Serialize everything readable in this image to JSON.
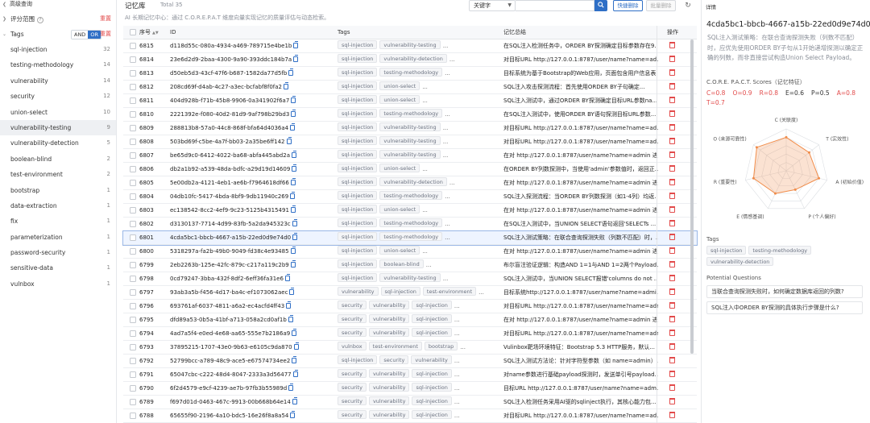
{
  "sidebar": {
    "advanced_search": "高级查询",
    "score_range": "评分范围",
    "score_reset": "重置",
    "tags_title": "Tags",
    "and_label": "AND",
    "or_label": "OR",
    "tags_reset": "重置",
    "tags": [
      {
        "name": "sql-injection",
        "count": "32"
      },
      {
        "name": "testing-methodology",
        "count": "14"
      },
      {
        "name": "vulnerability",
        "count": "14"
      },
      {
        "name": "security",
        "count": "12"
      },
      {
        "name": "union-select",
        "count": "10"
      },
      {
        "name": "vulnerability-testing",
        "count": "9"
      },
      {
        "name": "vulnerability-detection",
        "count": "5"
      },
      {
        "name": "boolean-blind",
        "count": "2"
      },
      {
        "name": "test-environment",
        "count": "2"
      },
      {
        "name": "bootstrap",
        "count": "1"
      },
      {
        "name": "data-extraction",
        "count": "1"
      },
      {
        "name": "fix",
        "count": "1"
      },
      {
        "name": "parameterization",
        "count": "1"
      },
      {
        "name": "password-security",
        "count": "1"
      },
      {
        "name": "sensitive-data",
        "count": "1"
      },
      {
        "name": "vulnbox",
        "count": "1"
      }
    ]
  },
  "main": {
    "title": "记忆库",
    "total": "Total 35",
    "subtitle": "AI 长期记忆中心：通过 C.O.R.E.P.A.T 维度向量实现记忆的质量评估与动态检索。",
    "search_field": "关键字",
    "search_placeholder": "",
    "quick_delete": "快捷删除",
    "batch_delete": "批量删除",
    "columns": {
      "seq": "序号",
      "id": "ID",
      "tags": "Tags",
      "summary": "记忆总结",
      "ops": "操作"
    },
    "rows": [
      {
        "seq": "6815",
        "id": "d118d55c-080a-4934-a469-789715e4be1b",
        "tags": [
          "sql-injection",
          "vulnerability-testing"
        ],
        "summary": "在SQL注入检测任务中，ORDER BY探测确定目标参数存在9..."
      },
      {
        "seq": "6814",
        "id": "23e6d2d9-2baa-4300-9a90-393ddc184b7a",
        "tags": [
          "sql-injection",
          "vulnerability-detection"
        ],
        "summary": "对目标URL http://127.0.0.1:8787/user/name?name=ad..."
      },
      {
        "seq": "6813",
        "id": "d50eb5d3-43cf-47f6-b687-1582da77d5fb",
        "tags": [
          "sql-injection",
          "testing-methodology"
        ],
        "summary": "目标系统为基于Bootstrap的Web应用，页面包含用户信息表..."
      },
      {
        "seq": "6812",
        "id": "208cd69f-d4ab-4c27-a3ec-bcfabf8f0fa2",
        "tags": [
          "sql-injection",
          "union-select"
        ],
        "summary": "SQL注入攻击探测流程：首先使用ORDER BY子句确定..."
      },
      {
        "seq": "6811",
        "id": "404d928b-f71b-45b8-9906-0a341902f6a7",
        "tags": [
          "sql-injection",
          "union-select"
        ],
        "summary": "SQL注入测试中，通过ORDER BY探测确定目标URL参数na..."
      },
      {
        "seq": "6810",
        "id": "2221392e-f080-40d2-81d9-9af798b29bd3",
        "tags": [
          "sql-injection",
          "testing-methodology"
        ],
        "summary": "在SQL注入测试中，使用ORDER BY语句探测目标URL参数..."
      },
      {
        "seq": "6809",
        "id": "288813b8-57a0-44c8-868f-bfa64d4036a4",
        "tags": [
          "sql-injection",
          "vulnerability-testing"
        ],
        "summary": "对目标URL http://127.0.0.1:8787/user/name?name=ad..."
      },
      {
        "seq": "6808",
        "id": "503bd69f-c5be-4a7f-bb03-2a35be6ff142",
        "tags": [
          "sql-injection",
          "vulnerability-testing"
        ],
        "summary": "对目标URL http://127.0.0.1:8787/user/name?name=ad..."
      },
      {
        "seq": "6807",
        "id": "be65d9c0-6412-4022-ba68-abfa445abd2a",
        "tags": [
          "sql-injection",
          "vulnerability-testing"
        ],
        "summary": "在对 http://127.0.0.1:8787/user/name?name=admin 进..."
      },
      {
        "seq": "6806",
        "id": "db2a1b92-a539-48da-bdfc-a29d19d14609",
        "tags": [
          "sql-injection",
          "union-select"
        ],
        "summary": "在ORDER BY列数探测中，当使用'admin'参数值时，返回正..."
      },
      {
        "seq": "6805",
        "id": "5e00db2a-4121-4eb1-ae6b-f7964618df66",
        "tags": [
          "sql-injection",
          "vulnerability-detection"
        ],
        "summary": "在对 http://127.0.0.1:8787/user/name?name=admin 进..."
      },
      {
        "seq": "6804",
        "id": "04db10fc-5417-4bda-8bf9-9db11940c269",
        "tags": [
          "sql-injection",
          "testing-methodology"
        ],
        "summary": "SQL注入探测流程：当ORDER BY列数探测（如1-4列）均返..."
      },
      {
        "seq": "6803",
        "id": "ec138542-8cc2-4ef9-9c23-5125b4315491",
        "tags": [
          "sql-injection",
          "union-select"
        ],
        "summary": "在对 http://127.0.0.1:8787/user/name?name=admin 进..."
      },
      {
        "seq": "6802",
        "id": "d3130137-7714-4d99-83fb-5a2da945323c",
        "tags": [
          "sql-injection",
          "testing-methodology"
        ],
        "summary": "在SQL注入测试中，当UNION SELECT语句返回'SELECTs ..."
      },
      {
        "seq": "6801",
        "id": "4cda5bc1-bbcb-4667-a15b-22ed0d9e74d0",
        "tags": [
          "sql-injection",
          "testing-methodology"
        ],
        "summary": "SQL注入测试策略：在联合查询探测失败（列数不匹配）时，..."
      },
      {
        "seq": "6800",
        "id": "5318297a-fa2b-49b0-9049-fd38c4e93485",
        "tags": [
          "sql-injection",
          "union-select"
        ],
        "summary": "在对 http://127.0.0.1:8787/user/name?name=admin 进..."
      },
      {
        "seq": "6799",
        "id": "2eb2263b-125e-42fc-879c-c217a119c2b9",
        "tags": [
          "sql-injection",
          "boolean-blind"
        ],
        "summary": "布尔盲注验证逻辑：构造AND 1=1与AND 1=2两个Payload..."
      },
      {
        "seq": "6798",
        "id": "0cd79247-3bba-432f-8df2-6eff36fa31e6",
        "tags": [
          "sql-injection",
          "vulnerability-testing"
        ],
        "summary": "SQL注入测试中，当UNION SELECT报错'columns do not ..."
      },
      {
        "seq": "6797",
        "id": "93ab3a5b-f456-4d17-ba4c-ef1073062aec",
        "tags": [
          "vulnerability",
          "sql-injection",
          "test-environment"
        ],
        "summary": "目标系统http://127.0.0.1:8787/user/name?name=admi..."
      },
      {
        "seq": "6796",
        "id": "693761af-6037-4811-a6a2-ec4acfd4ff43",
        "tags": [
          "security",
          "vulnerability",
          "sql-injection"
        ],
        "summary": "对目标URL http://127.0.0.1:8787/user/name?name=adm..."
      },
      {
        "seq": "6795",
        "id": "dfd89a53-0b5a-41bf-a713-058a2cd0af1b",
        "tags": [
          "security",
          "vulnerability",
          "sql-injection"
        ],
        "summary": "在对 http://127.0.0.1:8787/user/name?name=admin 进..."
      },
      {
        "seq": "6794",
        "id": "4ad7a5f4-e0ed-4e68-aa65-555e7b2186a9",
        "tags": [
          "security",
          "vulnerability",
          "sql-injection"
        ],
        "summary": "对目标URL http://127.0.0.1:8787/user/name?name=adm..."
      },
      {
        "seq": "6793",
        "id": "37895215-1707-43e0-9b63-e6105c9da870",
        "tags": [
          "vulnbox",
          "test-environment",
          "bootstrap"
        ],
        "summary": "Vulinbox靶场环境特征：Bootstrap 5.3 HTTP服务，默认..."
      },
      {
        "seq": "6792",
        "id": "52799bcc-a789-48c9-ace5-e67574734ee2",
        "tags": [
          "sql-injection",
          "security",
          "vulnerability"
        ],
        "summary": "SQL注入测试方法论：针对字符型参数（如 name=admin）..."
      },
      {
        "seq": "6791",
        "id": "65047cbc-c222-48d4-8047-2333a3d56477",
        "tags": [
          "security",
          "vulnerability",
          "sql-injection"
        ],
        "summary": "对name参数进行基础payload探测时，发送单引号payload..."
      },
      {
        "seq": "6790",
        "id": "6f2d4579-e9cf-4239-ae7b-97fb3b55989d",
        "tags": [
          "security",
          "vulnerability",
          "sql-injection"
        ],
        "summary": "目标URL http://127.0.0.1:8787/user/name?name=adm..."
      },
      {
        "seq": "6789",
        "id": "f697d01d-0463-467c-9913-00b668b64e14",
        "tags": [
          "security",
          "vulnerability",
          "sql-injection"
        ],
        "summary": "SQL注入检测任务采用AI驱的sqlinject执行，其核心能力包..."
      },
      {
        "seq": "6788",
        "id": "65655f90-2196-4a10-bdc5-16e26f8a8a54",
        "tags": [
          "security",
          "vulnerability",
          "sql-injection"
        ],
        "summary": "对目标URL http://127.0.0.1:8787/user/name?name=ad..."
      }
    ]
  },
  "detail": {
    "header": "详情",
    "id": "4cda5bc1-bbcb-4667-a15b-22ed0d9e74d0",
    "summary": "SQL注入测试策略：在联合查询探测失败（列数不匹配）时，应优先使用ORDER BY子句从1开始递增探测以确定正确的列数，而非直接尝试构造Union Select Payload。",
    "scores_title": "C.O.R.E. P.A.C.T. Scores（记忆特征）",
    "scores": [
      {
        "label": "C=0.8",
        "color": "#e24b4b"
      },
      {
        "label": "O=0.9",
        "color": "#e24b4b"
      },
      {
        "label": "R=0.8",
        "color": "#e24b4b"
      },
      {
        "label": "E=0.6",
        "color": "#333333"
      },
      {
        "label": "P=0.5",
        "color": "#333333"
      },
      {
        "label": "A=0.8",
        "color": "#e24b4b"
      },
      {
        "label": "T=0.7",
        "color": "#e24b4b"
      }
    ],
    "radar": {
      "axes": [
        {
          "label": "C (关联度)",
          "value": 0.8
        },
        {
          "label": "T (实效性)",
          "value": 0.7
        },
        {
          "label": "A (初始价值)",
          "value": 0.8
        },
        {
          "label": "P (个人偏好)",
          "value": 0.5
        },
        {
          "label": "E (情感基调)",
          "value": 0.6
        },
        {
          "label": "R (重要性)",
          "value": 0.8
        },
        {
          "label": "O (来源可靠性)",
          "value": 0.9
        }
      ],
      "color": "#f08c4a"
    },
    "tags_title": "Tags",
    "tags": [
      "sql-injection",
      "testing-methodology",
      "vulnerability-detection"
    ],
    "questions_title": "Potential Questions",
    "questions": [
      "当联合查询探测失败时，如何确定数据库返回的列数?",
      "SQL注入中ORDER BY探测的具体执行步骤是什么?"
    ]
  }
}
